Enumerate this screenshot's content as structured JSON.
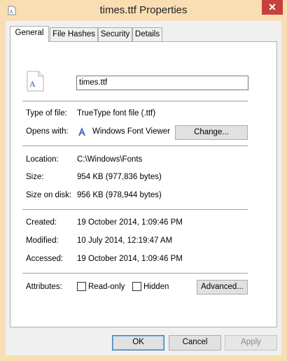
{
  "window": {
    "title": "times.ttf Properties",
    "close_label": "✕"
  },
  "tabs": [
    {
      "label": "General",
      "active": true
    },
    {
      "label": "File Hashes",
      "active": false
    },
    {
      "label": "Security",
      "active": false
    },
    {
      "label": "Details",
      "active": false
    }
  ],
  "general": {
    "file_name": "times.ttf",
    "type_label": "Type of file:",
    "type_value": "TrueType font file (.ttf)",
    "opens_label": "Opens with:",
    "opens_value": "Windows Font Viewer",
    "change_button": "Change...",
    "location_label": "Location:",
    "location_value": "C:\\Windows\\Fonts",
    "size_label": "Size:",
    "size_value": "954 KB (977,836 bytes)",
    "size_on_disk_label": "Size on disk:",
    "size_on_disk_value": "956 KB (978,944 bytes)",
    "created_label": "Created:",
    "created_value": "19 October 2014, 1:09:46 PM",
    "modified_label": "Modified:",
    "modified_value": "10 July 2014, 12:19:47 AM",
    "accessed_label": "Accessed:",
    "accessed_value": "19 October 2014, 1:09:46 PM",
    "attributes_label": "Attributes:",
    "readonly_label": "Read-only",
    "readonly_checked": false,
    "hidden_label": "Hidden",
    "hidden_checked": false,
    "advanced_button": "Advanced..."
  },
  "footer": {
    "ok": "OK",
    "cancel": "Cancel",
    "apply": "Apply"
  },
  "icons": {
    "app": "font-file-icon",
    "file": "font-file-icon",
    "opens_with": "font-viewer-icon"
  },
  "colors": {
    "title_bar": "#f9ddb3",
    "close_button": "#c7413a",
    "font_icon_accent": "#2b57a8"
  }
}
